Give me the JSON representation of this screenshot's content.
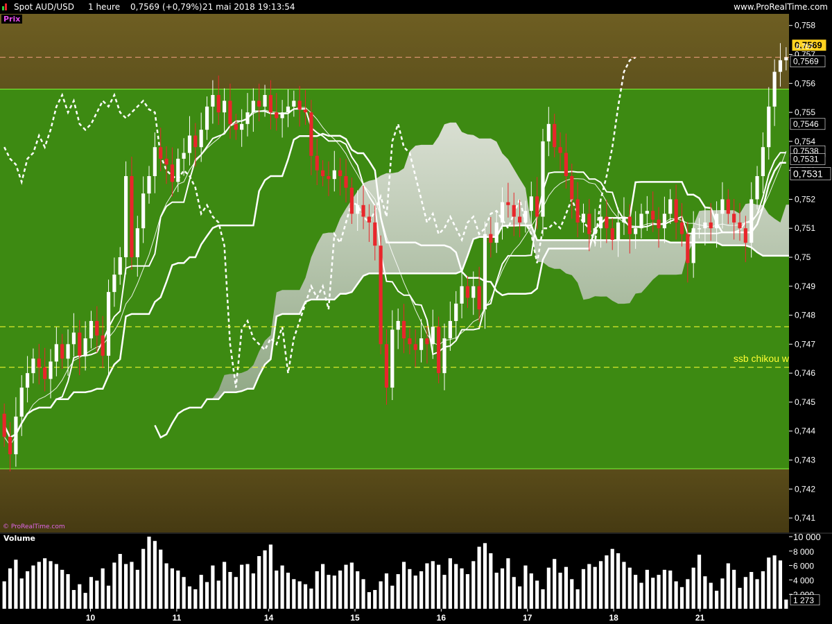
{
  "header": {
    "instrument": "Spot AUD/USD",
    "timeframe": "1 heure",
    "last": "0,7569",
    "change": "(+0,79%)",
    "datetime": "21 mai 2018 19:13:54",
    "site": "www.ProRealTime.com"
  },
  "panels": {
    "price_label": "Prix",
    "volume_label": "Volume",
    "watermark": "© ProRealTime.com",
    "annotation": "ssb chikou w"
  },
  "colors": {
    "bg_outer": "#6b5a1f",
    "bg_outer_low": "#4a3f14",
    "bg_green": "#3d8a12",
    "cloud": "#c8c8c2",
    "bull": "#ffffff",
    "bear": "#e8262b",
    "line": "#ffffff",
    "annotation": "#ffff33",
    "last_badge": "#ffd21f"
  },
  "chart_data": {
    "type": "candlestick",
    "ylim": [
      0.7405,
      0.7584
    ],
    "price_ticks": [
      "0,741",
      "0,742",
      "0,743",
      "0,744",
      "0,745",
      "0,746",
      "0,747",
      "0,748",
      "0,749",
      "0,75",
      "0,751",
      "0,752",
      "0,753",
      "0,754",
      "0,755",
      "0,756",
      "0,757",
      "0,758"
    ],
    "date_labels": [
      "10",
      "11",
      "14",
      "15",
      "16",
      "17",
      "18",
      "21"
    ],
    "date_positions": [
      15,
      30,
      46,
      61,
      76,
      91,
      106,
      121
    ],
    "zone_green": [
      0.7427,
      0.7558
    ],
    "h_lines": [
      {
        "value": 0.7569,
        "style": "dash",
        "color": "#f0a080"
      },
      {
        "value": 0.7476,
        "style": "dash",
        "color": "#ffff33"
      },
      {
        "value": 0.7462,
        "style": "dash",
        "color": "#ffff33",
        "label": "ssb chikou w"
      }
    ],
    "axis_markers": [
      {
        "value": 0.7569,
        "text": "0,7569",
        "style": "badge"
      },
      {
        "value": 0.7571,
        "text": "0,757",
        "style": "small"
      },
      {
        "value": 0.7569,
        "text": "0,7569",
        "style": "tag"
      },
      {
        "value": 0.7546,
        "text": "0,7546",
        "style": "tag"
      },
      {
        "value": 0.7538,
        "text": "0,7538",
        "style": "tag"
      },
      {
        "value": 0.7531,
        "text": "0,7531",
        "style": "tag"
      },
      {
        "value": 0.7531,
        "text": "0,7531",
        "style": "tag-big"
      }
    ],
    "candles_close": [
      0.7438,
      0.7432,
      0.7445,
      0.7455,
      0.746,
      0.7465,
      0.7462,
      0.7458,
      0.7464,
      0.747,
      0.7465,
      0.747,
      0.7474,
      0.7466,
      0.7472,
      0.7478,
      0.7473,
      0.7466,
      0.7488,
      0.7494,
      0.75,
      0.7528,
      0.75,
      0.751,
      0.7522,
      0.7528,
      0.7538,
      0.7534,
      0.7532,
      0.7526,
      0.7534,
      0.7536,
      0.7542,
      0.7538,
      0.7544,
      0.7552,
      0.7556,
      0.755,
      0.7554,
      0.7546,
      0.7544,
      0.7546,
      0.755,
      0.7554,
      0.7552,
      0.7556,
      0.755,
      0.7548,
      0.755,
      0.7552,
      0.7554,
      0.7551,
      0.755,
      0.7535,
      0.753,
      0.7528,
      0.7527,
      0.753,
      0.7528,
      0.7524,
      0.7515,
      0.7518,
      0.7514,
      0.7512,
      0.7504,
      0.747,
      0.7455,
      0.7475,
      0.7478,
      0.7472,
      0.747,
      0.7468,
      0.7472,
      0.747,
      0.7476,
      0.746,
      0.7472,
      0.7478,
      0.7484,
      0.749,
      0.7486,
      0.749,
      0.7482,
      0.7508,
      0.7505,
      0.7512,
      0.7519,
      0.7518,
      0.7514,
      0.7512,
      0.7516,
      0.7521,
      0.7514,
      0.754,
      0.7546,
      0.7538,
      0.7536,
      0.7528,
      0.752,
      0.7512,
      0.7515,
      0.7508,
      0.751,
      0.7514,
      0.751,
      0.7506,
      0.7512,
      0.7514,
      0.7508,
      0.751,
      0.7515,
      0.7516,
      0.7513,
      0.751,
      0.7515,
      0.752,
      0.7512,
      0.7508,
      0.7498,
      0.751,
      0.751,
      0.7512,
      0.751,
      0.7515,
      0.752,
      0.7515,
      0.7512,
      0.751,
      0.7505,
      0.752,
      0.7528,
      0.7538,
      0.7552,
      0.7564,
      0.7568,
      0.7569
    ],
    "volume_axis": {
      "ylim": [
        0,
        10000
      ],
      "ticks": [
        "10 000",
        "8 000",
        "6 000",
        "4 000",
        "2 000"
      ],
      "last": "1 273",
      "last_value": 1273
    },
    "volume": [
      3800,
      5600,
      6800,
      4200,
      5200,
      6000,
      6500,
      7000,
      6600,
      6200,
      5400,
      4800,
      2600,
      3400,
      2200,
      4400,
      3900,
      5600,
      3200,
      6400,
      7600,
      6200,
      6500,
      5400,
      8300,
      10000,
      9400,
      8200,
      6300,
      5600,
      5300,
      4400,
      3100,
      2700,
      4700,
      3700,
      6000,
      3900,
      6500,
      5100,
      4400,
      6100,
      6200,
      4900,
      7300,
      8100,
      8900,
      5300,
      6000,
      5000,
      4100,
      3800,
      3400,
      2800,
      5200,
      6200,
      4700,
      4600,
      5300,
      6100,
      6400,
      5200,
      4100,
      2300,
      2600,
      3800,
      4900,
      3200,
      4800,
      6500,
      5500,
      4600,
      5200,
      6300,
      6600,
      6100,
      4700,
      7000,
      6200,
      5600,
      4800,
      6600,
      8600,
      9100,
      7700,
      5000,
      5600,
      7000,
      4400,
      3100,
      6000,
      4900,
      3900,
      2700,
      5700,
      6900,
      5000,
      5800,
      4100,
      2700,
      5500,
      6200,
      5800,
      6600,
      7400,
      8300,
      7700,
      6500,
      5700,
      4700,
      3600,
      5400,
      4300,
      4700,
      5400,
      5300,
      3800,
      3000,
      4100,
      5700,
      7500,
      4500,
      3600,
      2500,
      4200,
      6300,
      5400,
      2900,
      4400,
      5100,
      4100,
      5200,
      7100,
      7400,
      6700,
      1273
    ]
  }
}
